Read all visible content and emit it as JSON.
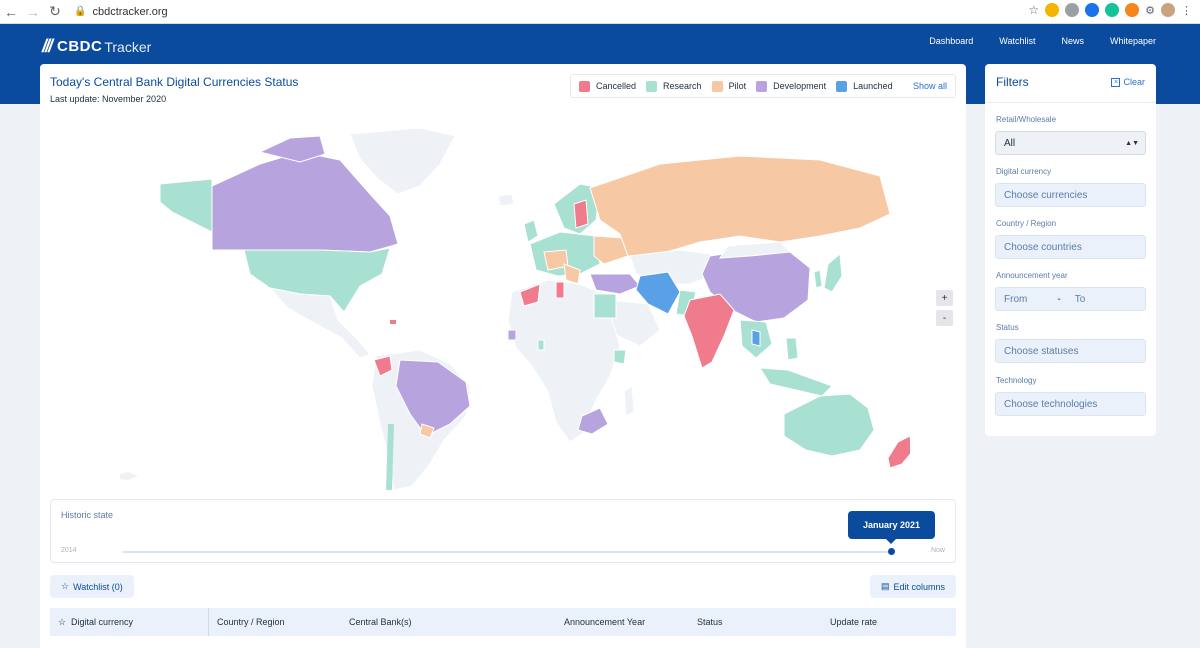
{
  "browser": {
    "url": "cbdctracker.org"
  },
  "header": {
    "logo_bold": "CBDC",
    "logo_light": "Tracker",
    "nav": [
      "Dashboard",
      "Watchlist",
      "News",
      "Whitepaper"
    ]
  },
  "status_panel": {
    "title": "Today's Central Bank Digital Currencies Status",
    "subtitle": "Last update: November 2020",
    "legend": [
      {
        "label": "Cancelled",
        "color": "#f07b8c"
      },
      {
        "label": "Research",
        "color": "#a8e0d2"
      },
      {
        "label": "Pilot",
        "color": "#f6c8a3"
      },
      {
        "label": "Development",
        "color": "#b7a3de"
      },
      {
        "label": "Launched",
        "color": "#5aa0e6"
      }
    ],
    "show_all": "Show all",
    "zoom_in": "+",
    "zoom_out": "-"
  },
  "historic": {
    "label": "Historic state",
    "start": "2014",
    "end": "Now",
    "current": "January 2021",
    "position": 1.0
  },
  "toolbar": {
    "watchlist": "Watchlist (0)",
    "edit_columns": "Edit columns"
  },
  "table": {
    "columns": [
      "Digital currency",
      "Country / Region",
      "Central Bank(s)",
      "Announcement Year",
      "Status",
      "Update rate"
    ]
  },
  "filters": {
    "title": "Filters",
    "clear": "Clear",
    "fields": [
      {
        "label": "Retail/Wholesale",
        "value": "All"
      },
      {
        "label": "Digital currency",
        "placeholder": "Choose currencies"
      },
      {
        "label": "Country / Region",
        "placeholder": "Choose countries"
      },
      {
        "label": "Announcement year",
        "from": "From",
        "to": "To"
      },
      {
        "label": "Status",
        "placeholder": "Choose statuses"
      },
      {
        "label": "Technology",
        "placeholder": "Choose technologies"
      }
    ]
  }
}
